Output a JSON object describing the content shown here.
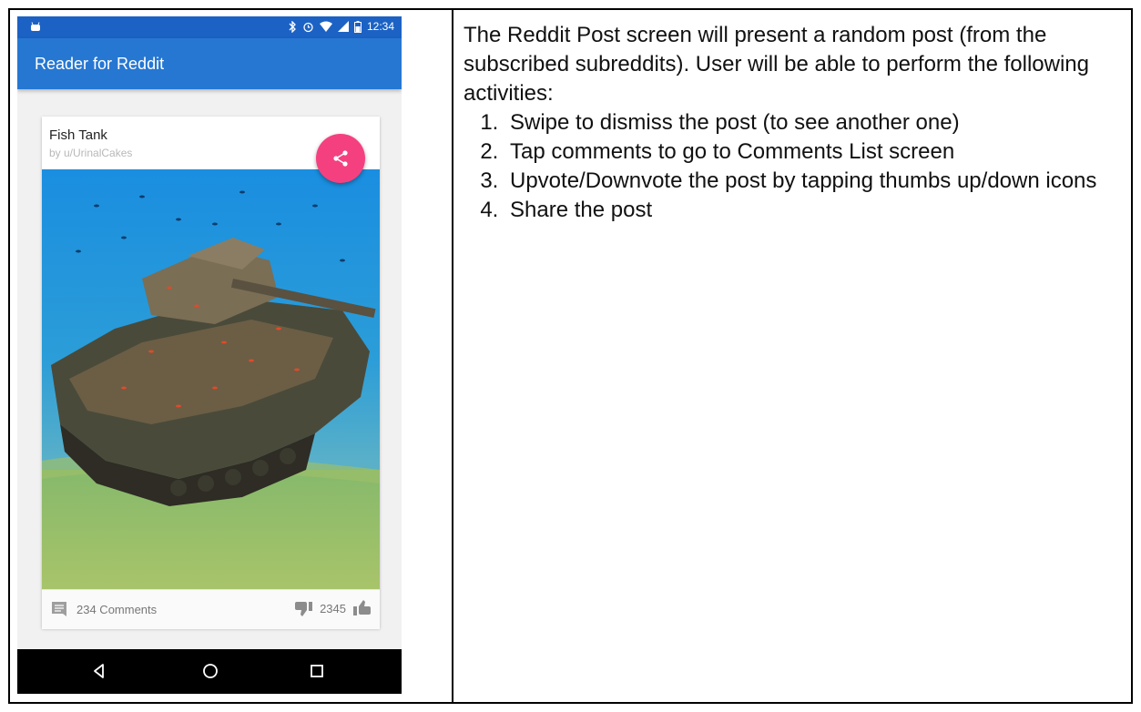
{
  "status_bar": {
    "time": "12:34"
  },
  "app_bar": {
    "title": "Reader for Reddit"
  },
  "post": {
    "title": "Fish Tank",
    "author": "by u/UrinalCakes",
    "comments_label": "234 Comments",
    "score": "2345"
  },
  "description": {
    "intro": "The Reddit Post screen will present a random post (from the subscribed subreddits). User will be able to perform the following activities:",
    "items": [
      "Swipe to dismiss the post (to see another one)",
      "Tap comments to go to Comments List screen",
      "Upvote/Downvote the post by tapping thumbs up/down icons",
      "Share the post"
    ]
  },
  "colors": {
    "status_bar": "#1c62c4",
    "app_bar": "#2677d2",
    "fab": "#f5407f",
    "nav_bar": "#000000"
  },
  "icons": [
    "android-icon",
    "bluetooth-icon",
    "alarm-icon",
    "wifi-icon",
    "signal-icon",
    "battery-icon",
    "share-icon",
    "comment-icon",
    "thumbs-down-icon",
    "thumbs-up-icon",
    "back-icon",
    "home-icon",
    "recents-icon"
  ]
}
